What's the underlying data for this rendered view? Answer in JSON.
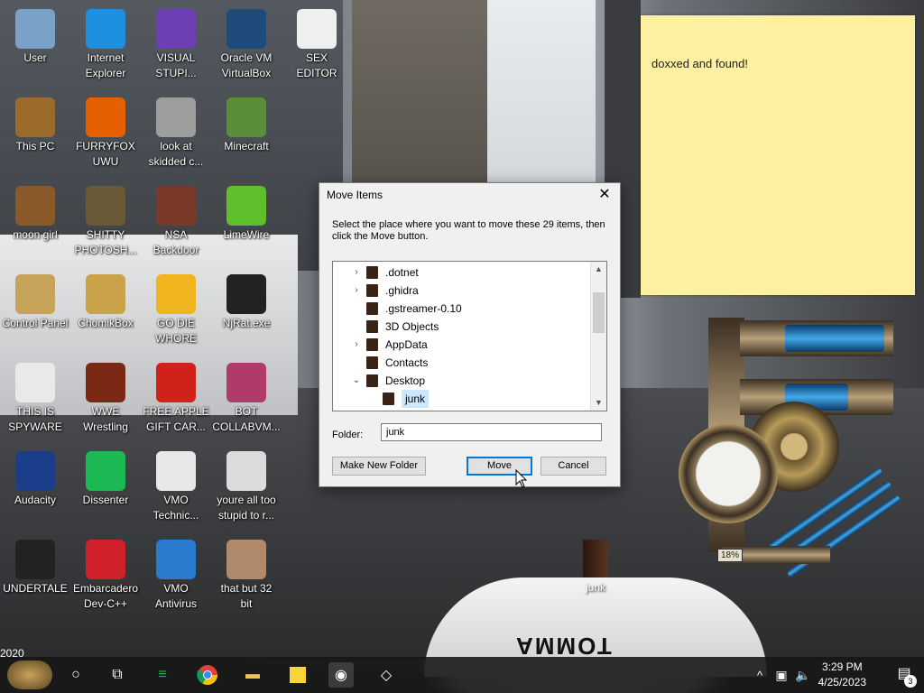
{
  "wallpaper": {
    "watermark_year": "2020",
    "helmet_text": "TOMMA"
  },
  "desktop_icons": [
    {
      "name": "user",
      "label": "User",
      "icon": "user-face-icon",
      "color": "#7aa1c8"
    },
    {
      "name": "internet-explorer",
      "label": "Internet\nExplorer",
      "icon": "edge-icon",
      "color": "#1f8fe0"
    },
    {
      "name": "visual-studio",
      "label": "VISUAL\nSTUPI...",
      "icon": "visual-studio-icon",
      "color": "#6c3fb5"
    },
    {
      "name": "virtualbox",
      "label": "Oracle VM\nVirtualBox",
      "icon": "virtualbox-icon",
      "color": "#1f4b7a"
    },
    {
      "name": "sex-editor",
      "label": "SEX\nEDITOR",
      "icon": "hxd-icon",
      "color": "#efefef"
    },
    {
      "name": "this-pc",
      "label": "This PC",
      "icon": "computer-icon",
      "color": "#9b6b2c"
    },
    {
      "name": "furryfox",
      "label": "FURRYFOX\nUWU",
      "icon": "firefox-icon",
      "color": "#e66000"
    },
    {
      "name": "skidded",
      "label": "look at\nskidded c...",
      "icon": "copy-icon",
      "color": "#9e9e9e"
    },
    {
      "name": "minecraft",
      "label": "Minecraft",
      "icon": "grass-block-icon",
      "color": "#5a8e3a"
    },
    {
      "name": "moon-girl",
      "label": "moon girl",
      "icon": "book-icon",
      "color": "#8a5a2a"
    },
    {
      "name": "gimp",
      "label": "SHITTY\nPHOTOSH...",
      "icon": "gimp-icon",
      "color": "#6b5a3a"
    },
    {
      "name": "nsa-backdoor",
      "label": "NSA\nBackdoor",
      "icon": "chest-icon",
      "color": "#7a3a2a"
    },
    {
      "name": "limewire",
      "label": "LimeWire",
      "icon": "limewire-icon",
      "color": "#5fbf2a"
    },
    {
      "name": "control-panel",
      "label": "Control Panel",
      "icon": "control-panel-icon",
      "color": "#c7a35a"
    },
    {
      "name": "chomikbox",
      "label": "ChomikBox",
      "icon": "hamster-icon",
      "color": "#c9a24a"
    },
    {
      "name": "go-die",
      "label": "GO DIE\nWHORE",
      "icon": "de-icon",
      "color": "#f0b41e"
    },
    {
      "name": "njrat",
      "label": "NjRat.exe",
      "icon": "skull-icon",
      "color": "#222222"
    },
    {
      "name": "chrome",
      "label": "THIS IS\nSPYWARE",
      "icon": "chrome-icon",
      "color": "#e9e9e9"
    },
    {
      "name": "wwe",
      "label": "WWE\nWrestling",
      "icon": "cabinet-icon",
      "color": "#7a2a14"
    },
    {
      "name": "free-apple",
      "label": "FREE APPLE\nGIFT CAR...",
      "icon": "apple-icon",
      "color": "#d0221a"
    },
    {
      "name": "bot-collab",
      "label": "BOT\nCOLLABVM...",
      "icon": "monitor-icon",
      "color": "#b03a6a"
    },
    {
      "name": "audacity",
      "label": "Audacity",
      "icon": "headphones-icon",
      "color": "#1a3e8a"
    },
    {
      "name": "dissenter",
      "label": "Dissenter",
      "icon": "spotify-icon",
      "color": "#1db954"
    },
    {
      "name": "vmo-technician",
      "label": "VMO\nTechnic...",
      "icon": "doctor-icon",
      "color": "#e8e8e8"
    },
    {
      "name": "stupid",
      "label": "youre all too\nstupid to r...",
      "icon": "portrait-icon",
      "color": "#dcdcdc"
    },
    {
      "name": "undertale",
      "label": "UNDERTALE",
      "icon": "unity-icon",
      "color": "#222222"
    },
    {
      "name": "devcpp",
      "label": "Embarcadero\nDev-C++",
      "icon": "devcpp-icon",
      "color": "#d0202a"
    },
    {
      "name": "vmo-antivirus",
      "label": "VMO\nAntivirus",
      "icon": "shield-icon",
      "color": "#2a7ad0"
    },
    {
      "name": "32bit",
      "label": "that but 32\nbit",
      "icon": "portrait-icon",
      "color": "#b08a6a"
    }
  ],
  "sticky_note": {
    "text": "doxxed and found!"
  },
  "gadget": {
    "percent": "18%"
  },
  "dialog": {
    "title": "Move Items",
    "instruction": "Select the place where you want to move these 29 items, then click the Move button.",
    "tree": [
      {
        "label": ".dotnet",
        "expandable": true,
        "level": 1
      },
      {
        "label": ".ghidra",
        "expandable": true,
        "level": 1
      },
      {
        "label": ".gstreamer-0.10",
        "expandable": false,
        "level": 1
      },
      {
        "label": "3D Objects",
        "expandable": false,
        "level": 1
      },
      {
        "label": "AppData",
        "expandable": true,
        "level": 1
      },
      {
        "label": "Contacts",
        "expandable": false,
        "level": 1
      },
      {
        "label": "Desktop",
        "expandable": true,
        "expanded": true,
        "level": 1
      },
      {
        "label": "junk",
        "expandable": false,
        "level": 2,
        "selected": true
      }
    ],
    "folder_label": "Folder:",
    "folder_value": "junk",
    "make_new_folder": "Make New Folder",
    "move": "Move",
    "cancel": "Cancel"
  },
  "desktop_junk": {
    "label": "junk"
  },
  "taskbar": {
    "time": "3:29 PM",
    "date": "4/25/2023",
    "notification_count": "3",
    "pinned": [
      "search-icon",
      "task-view-icon",
      "spotify-icon",
      "chrome-icon",
      "file-explorer-icon",
      "sticky-notes-icon",
      "webcam-icon",
      "unity-icon"
    ]
  }
}
